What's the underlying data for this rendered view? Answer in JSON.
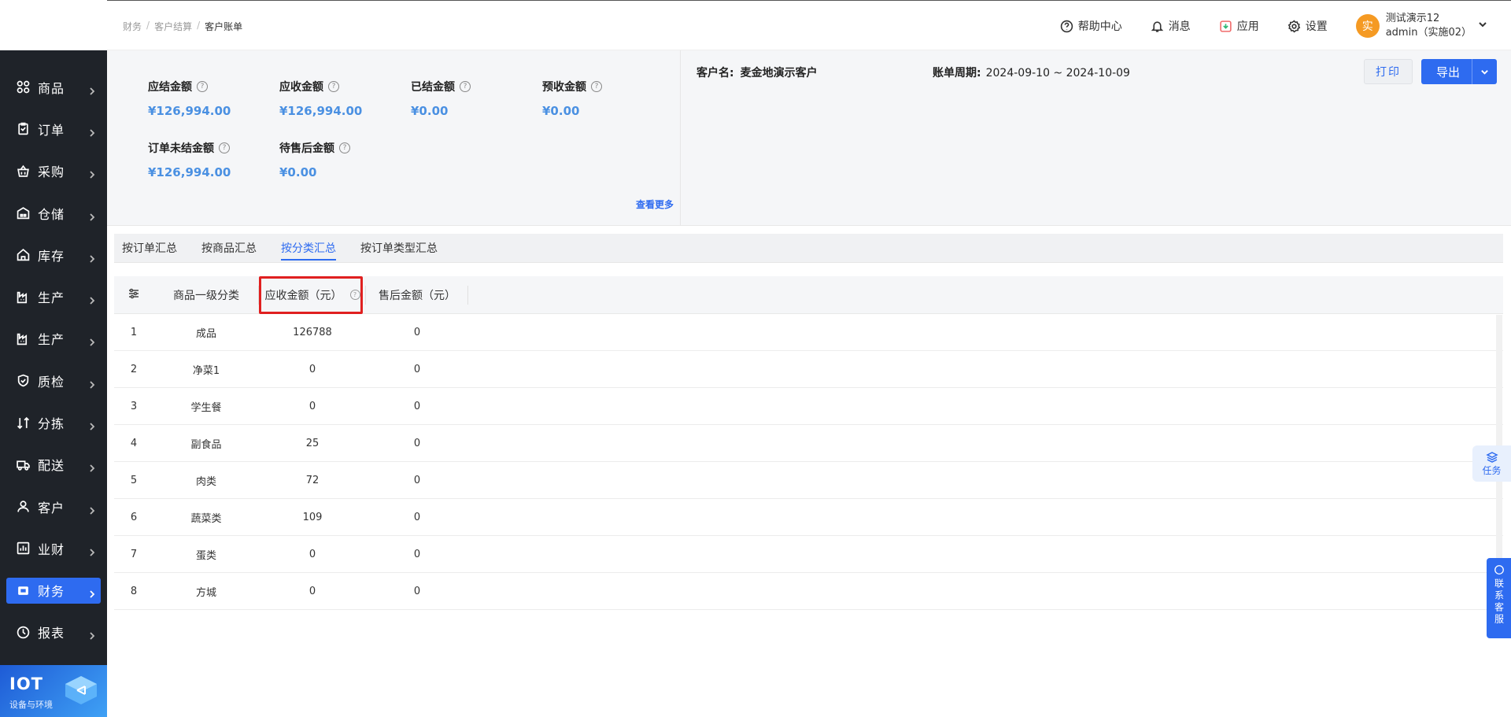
{
  "header": {
    "breadcrumb": [
      "财务",
      "客户结算",
      "客户账单"
    ],
    "help": "帮助中心",
    "messages": "消息",
    "apps": "应用",
    "settings": "设置",
    "user": {
      "avatar_char": "实",
      "name": "测试演示12",
      "account": "admin（实施02）"
    }
  },
  "sidebar": {
    "items": [
      {
        "label": "商品",
        "icon": "grid-icon"
      },
      {
        "label": "订单",
        "icon": "clipboard-icon"
      },
      {
        "label": "采购",
        "icon": "basket-icon"
      },
      {
        "label": "仓储",
        "icon": "warehouse-icon"
      },
      {
        "label": "库存",
        "icon": "home-icon"
      },
      {
        "label": "生产",
        "icon": "factory-icon"
      },
      {
        "label": "生产",
        "icon": "factory-icon"
      },
      {
        "label": "质检",
        "icon": "shield-icon"
      },
      {
        "label": "分拣",
        "icon": "sort-icon"
      },
      {
        "label": "配送",
        "icon": "truck-icon"
      },
      {
        "label": "客户",
        "icon": "user-icon"
      },
      {
        "label": "业财",
        "icon": "chart-icon"
      },
      {
        "label": "财务",
        "icon": "wallet-icon",
        "active": true
      },
      {
        "label": "报表",
        "icon": "clock-icon"
      }
    ],
    "iot": {
      "title": "IOT",
      "subtitle": "设备与环境"
    }
  },
  "summary": {
    "metrics": [
      {
        "label": "应结金额",
        "value": "¥126,994.00"
      },
      {
        "label": "应收金额",
        "value": "¥126,994.00"
      },
      {
        "label": "已结金额",
        "value": "¥0.00"
      },
      {
        "label": "预收金额",
        "value": "¥0.00"
      },
      {
        "label": "订单未结金额",
        "value": "¥126,994.00"
      },
      {
        "label": "待售后金额",
        "value": "¥0.00"
      }
    ],
    "see_more": "查看更多",
    "customer_label": "客户名:",
    "customer_value": "麦金地演示客户",
    "period_label": "账单周期:",
    "period_value": "2024-09-10 ~ 2024-10-09",
    "print_label": "打印",
    "export_label": "导出"
  },
  "tabs": [
    {
      "label": "按订单汇总",
      "active": false
    },
    {
      "label": "按商品汇总",
      "active": false
    },
    {
      "label": "按分类汇总",
      "active": true
    },
    {
      "label": "按订单类型汇总",
      "active": false
    }
  ],
  "table": {
    "headers": {
      "category": "商品一级分类",
      "amount": "应收金额（元）",
      "after_sale": "售后金额（元）"
    },
    "rows": [
      {
        "idx": "1",
        "category": "成品",
        "amount": "126788",
        "after_sale": "0"
      },
      {
        "idx": "2",
        "category": "净菜1",
        "amount": "0",
        "after_sale": "0"
      },
      {
        "idx": "3",
        "category": "学生餐",
        "amount": "0",
        "after_sale": "0"
      },
      {
        "idx": "4",
        "category": "副食品",
        "amount": "25",
        "after_sale": "0"
      },
      {
        "idx": "5",
        "category": "肉类",
        "amount": "72",
        "after_sale": "0"
      },
      {
        "idx": "6",
        "category": "蔬菜类",
        "amount": "109",
        "after_sale": "0"
      },
      {
        "idx": "7",
        "category": "蛋类",
        "amount": "0",
        "after_sale": "0"
      },
      {
        "idx": "8",
        "category": "方城",
        "amount": "0",
        "after_sale": "0"
      }
    ]
  },
  "floating": {
    "task": "任务",
    "service": "联系客服"
  },
  "colors": {
    "primary": "#2e6bf0",
    "sidebar_bg": "#1f2329",
    "highlight": "#e02020",
    "amount": "#4a90e2"
  }
}
